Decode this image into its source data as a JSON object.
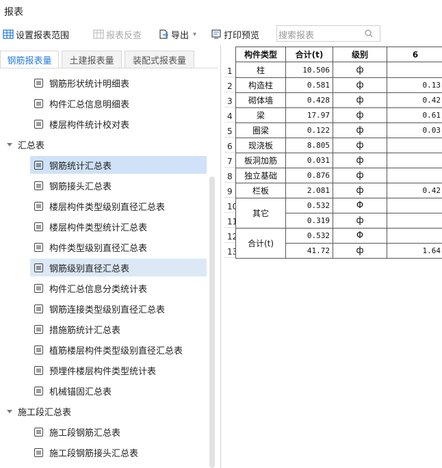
{
  "window": {
    "title": "报表"
  },
  "toolbar": {
    "set_range": "设置报表范围",
    "report_check": "报表反查",
    "export": "导出",
    "print_preview": "打印预览",
    "search_placeholder": "搜索报表"
  },
  "tabs": [
    {
      "label": "钢筋报表量",
      "active": true
    },
    {
      "label": "土建报表量",
      "active": false
    },
    {
      "label": "装配式报表量",
      "active": false
    }
  ],
  "tree": {
    "top_items": [
      "钢筋形状统计明细表",
      "构件汇总信息明细表",
      "楼层构件统计校对表"
    ],
    "group1": "汇总表",
    "group1_items": [
      {
        "label": "钢筋统计汇总表",
        "selected": true
      },
      {
        "label": "钢筋接头汇总表",
        "selected": false
      },
      {
        "label": "楼层构件类型级别直径汇总表",
        "selected": false
      },
      {
        "label": "楼层构件类型统计汇总表",
        "selected": false
      },
      {
        "label": "构件类型级别直径汇总表",
        "selected": false
      },
      {
        "label": "钢筋级别直径汇总表",
        "selected": true
      },
      {
        "label": "构件汇总信息分类统计表",
        "selected": false
      },
      {
        "label": "钢筋连接类型级别直径汇总表",
        "selected": false
      },
      {
        "label": "措施筋统计汇总表",
        "selected": false
      },
      {
        "label": "植筋楼层构件类型级别直径汇总表",
        "selected": false
      },
      {
        "label": "预埋件楼层构件类型统计表",
        "selected": false
      },
      {
        "label": "机械锚固汇总表",
        "selected": false
      }
    ],
    "group2": "施工段汇总表",
    "group2_items": [
      "施工段钢筋汇总表",
      "施工段钢筋接头汇总表"
    ]
  },
  "table": {
    "headers": [
      "构件类型",
      "合计(t)",
      "级别",
      "6"
    ],
    "row_numbers": [
      "1",
      "2",
      "3",
      "4",
      "5",
      "6",
      "7",
      "8",
      "9",
      "10",
      "11",
      "12",
      "13"
    ],
    "rows": [
      {
        "type": "柱",
        "total": "10.506",
        "level": "ф",
        "c6": ""
      },
      {
        "type": "构造柱",
        "total": "0.581",
        "level": "ф",
        "c6": "0.13"
      },
      {
        "type": "砌体墙",
        "total": "0.428",
        "level": "ф",
        "c6": "0.42"
      },
      {
        "type": "梁",
        "total": "17.97",
        "level": "ф",
        "c6": "0.61"
      },
      {
        "type": "圈梁",
        "total": "0.122",
        "level": "ф",
        "c6": "0.03"
      },
      {
        "type": "现浇板",
        "total": "8.805",
        "level": "ф",
        "c6": ""
      },
      {
        "type": "板洞加筋",
        "total": "0.031",
        "level": "ф",
        "c6": ""
      },
      {
        "type": "独立基础",
        "total": "0.876",
        "level": "ф",
        "c6": ""
      },
      {
        "type": "栏板",
        "total": "2.081",
        "level": "ф",
        "c6": "0.42"
      }
    ],
    "other": {
      "type": "其它",
      "total1": "0.532",
      "level1": "Φ",
      "total2": "0.319",
      "level2": "ф"
    },
    "sum": {
      "type": "合计(t)",
      "total1": "0.532",
      "level1": "Φ",
      "total2": "41.72",
      "level2": "ф",
      "c6": "1.64"
    }
  }
}
